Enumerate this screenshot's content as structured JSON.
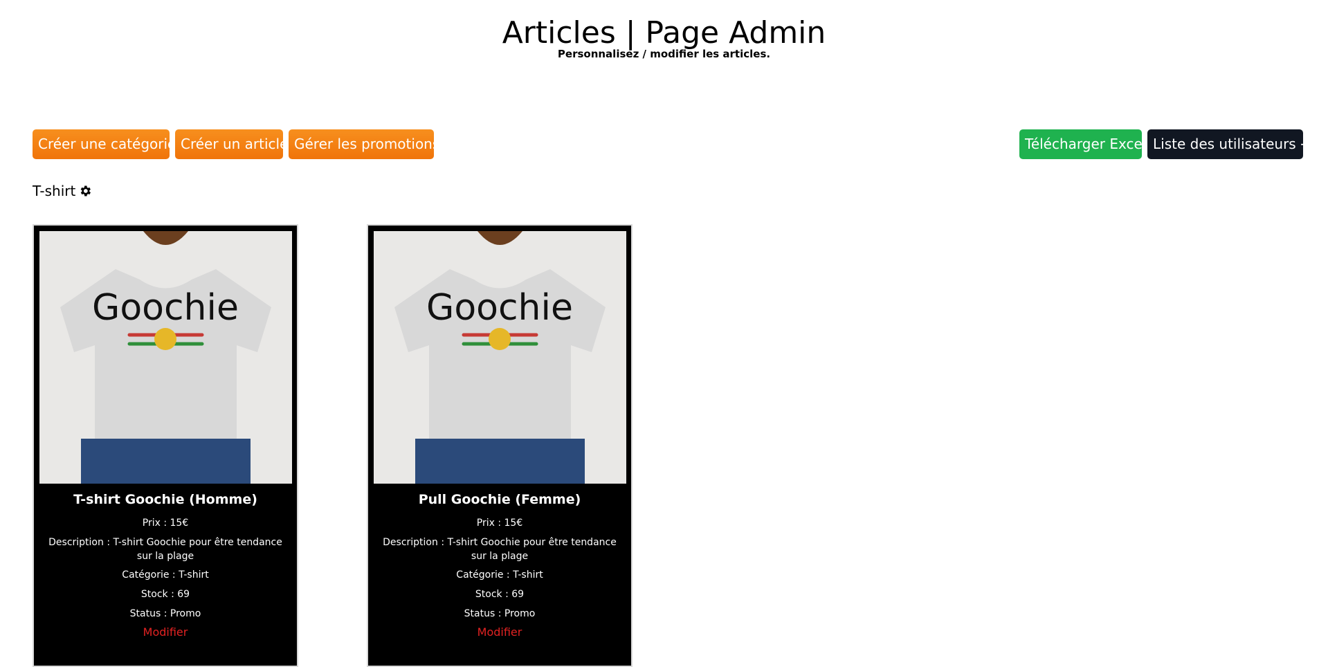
{
  "header": {
    "title": "Articles | Page Admin",
    "subtitle": "Personnalisez / modifier les articles."
  },
  "toolbar": {
    "create_category": "Créer une catégorie",
    "create_article": "Créer un article",
    "manage_promotions": "Gérer les promotions",
    "download_excel": "Télécharger Excel",
    "users_list": "Liste des utilisateurs →"
  },
  "colors": {
    "orange": "#f0740a",
    "green": "#1fb24f",
    "dark": "#111722",
    "modify_link": "#e32222"
  },
  "category": {
    "name": "T-shirt",
    "icon": "gear-icon"
  },
  "articles": [
    {
      "name": "T-shirt Goochie (Homme)",
      "price": "Prix : 15€",
      "description": "Description : T-shirt Goochie pour être tendance sur la plage",
      "category": "Catégorie : T-shirt",
      "stock": "Stock : 69",
      "status": "Status : Promo",
      "modify": "Modifier",
      "image_text": "Goochie"
    },
    {
      "name": "Pull Goochie (Femme)",
      "price": "Prix : 15€",
      "description": "Description : T-shirt Goochie pour être tendance sur la plage",
      "category": "Catégorie : T-shirt",
      "stock": "Stock : 69",
      "status": "Status : Promo",
      "modify": "Modifier",
      "image_text": "Goochie"
    }
  ]
}
